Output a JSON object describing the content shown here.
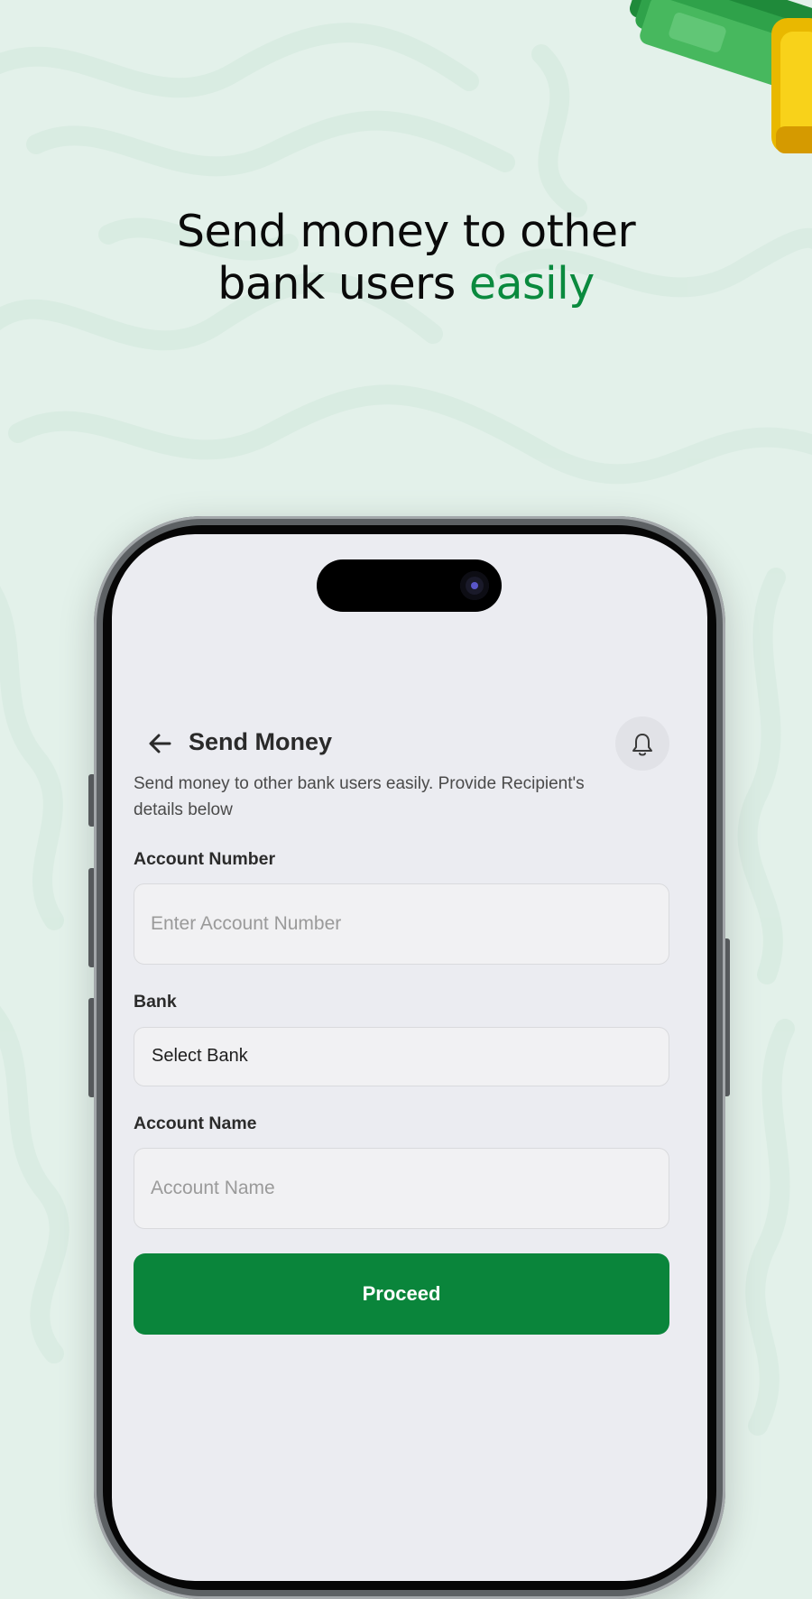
{
  "headline": {
    "line1": "Send money to other",
    "line2_prefix": "bank users ",
    "line2_accent": "easily"
  },
  "colors": {
    "accent": "#0a8a3e",
    "primary_button": "#0a853b",
    "background": "#e3f1ea",
    "screen_background": "#ebecf1"
  },
  "screen": {
    "back_icon": "arrow-left-icon",
    "title": "Send Money",
    "notification_icon": "bell-icon",
    "description": "Send money to other bank users easily. Provide Recipient's details below",
    "fields": {
      "account_number": {
        "label": "Account Number",
        "placeholder": "Enter Account Number",
        "value": ""
      },
      "bank": {
        "label": "Bank",
        "selected": "Select Bank"
      },
      "account_name": {
        "label": "Account Name",
        "placeholder": "Account Name",
        "value": ""
      }
    },
    "proceed_label": "Proceed"
  }
}
